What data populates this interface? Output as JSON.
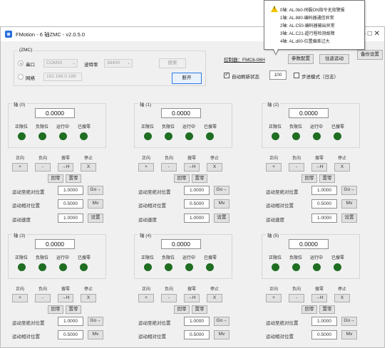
{
  "window": {
    "title": "FMotion - 6 轴ZMC - v2.0.5.0",
    "icon": "app-icon",
    "controls": "— □ ✕"
  },
  "connection": {
    "group_title": "(ZMC)",
    "serial_label": "串口",
    "serial_port": "COM30",
    "baud_label": "波特率",
    "baud_value": "38400",
    "network_label": "网络",
    "ip_value": "192.168.0.188",
    "search_button": "搜索",
    "disconnect_button": "断开"
  },
  "controller": {
    "label": "控制器：FMC6-06H",
    "param_button": "参数配置",
    "back_home_button": "往返运动",
    "refresh_label": "自动刷新状态",
    "refresh_interval": "100",
    "step_mode_label": "步进模式（日志）",
    "right_button": "备份设置"
  },
  "tooltip": {
    "icon": "warning-icon",
    "lines": [
      "0轴: AL.0b0-伺服ON指令无效警报",
      "1轴: AL.880-编码器通信异常",
      "2轴: AL.C50-编码器输出异常",
      "3轴: AL.C21-超行程检测故障",
      "4轴: AL.d00-位置偏差过大"
    ]
  },
  "axis_labels": {
    "status": [
      "正限位",
      "负限位",
      "运行中",
      "已搜零"
    ],
    "dir": [
      "正向",
      "负向",
      "搜零",
      "停止"
    ],
    "jog": [
      "+",
      "-",
      "→H",
      "X"
    ],
    "clear_button": "回零",
    "zero_button": "置零",
    "abs_label": "运动至绝对位置",
    "rel_label": "运动相对位置",
    "speed_label": "运动速度",
    "go_button": "Go→",
    "mv_button": "Mv",
    "set_button": "设置"
  },
  "axes": [
    {
      "title": "轴 (0)",
      "position": "0.0000",
      "abs": "1.0000",
      "rel": "0.5000",
      "speed": "1.0000"
    },
    {
      "title": "轴 (1)",
      "position": "0.0000",
      "abs": "1.0000",
      "rel": "0.5000",
      "speed": "1.0000"
    },
    {
      "title": "轴 (2)",
      "position": "0.0000",
      "abs": "1.0000",
      "rel": "0.5000",
      "speed": "1.0000"
    },
    {
      "title": "轴 (3)",
      "position": "0.0000",
      "abs": "1.0000",
      "rel": "0.5000"
    },
    {
      "title": "轴 (4)",
      "position": "0.0000",
      "abs": "1.0000",
      "rel": "0.5000"
    },
    {
      "title": "轴 (5)",
      "position": "0.0000",
      "abs": "1.0000",
      "rel": "0.5000"
    }
  ],
  "colors": {
    "led_on": "#1f6e22",
    "focus": "#2c7be5",
    "warning": "#f2c300"
  }
}
